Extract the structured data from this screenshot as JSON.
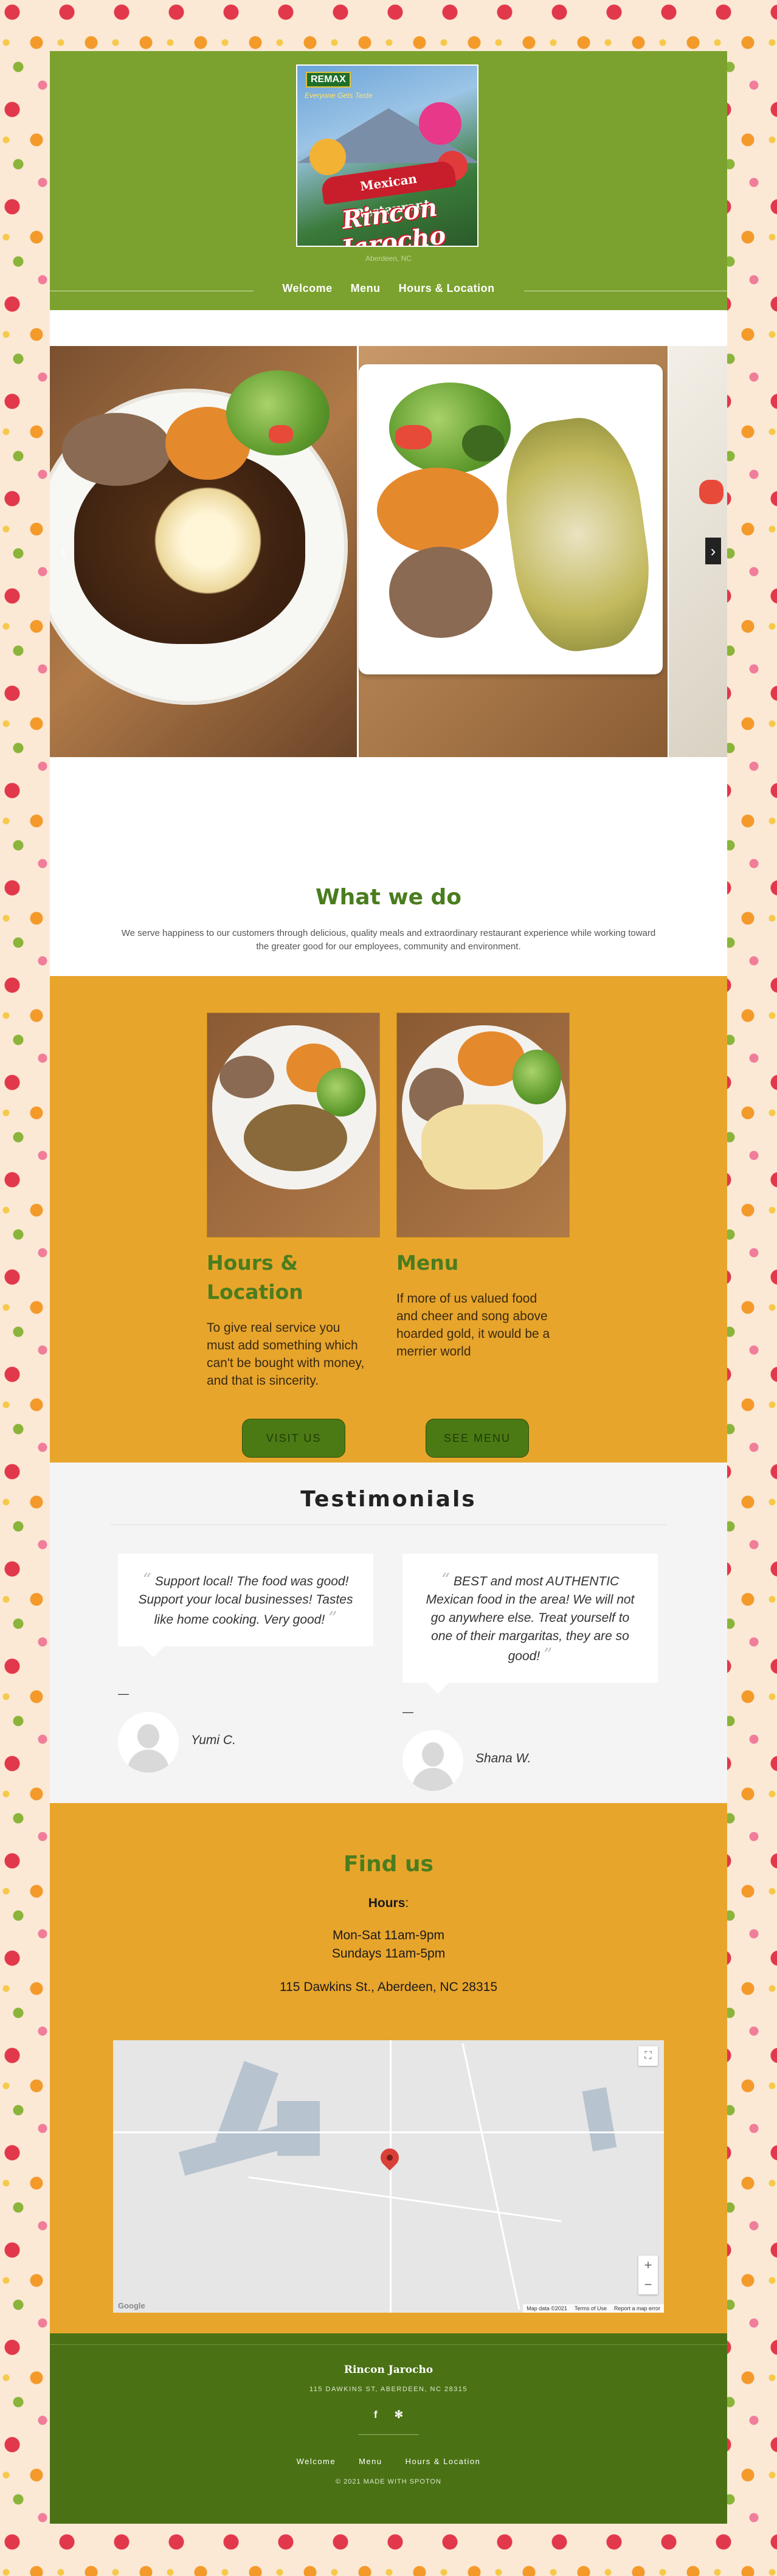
{
  "header": {
    "logo": {
      "tag": "REMAX",
      "subtitle": "Everyone Gets Taste",
      "banner": "Mexican Restaurant",
      "script": "Rincon Jarocho"
    },
    "location": "Aberdeen, NC",
    "nav": [
      "Welcome",
      "Menu",
      "Hours & Location"
    ]
  },
  "slider": {
    "prev_icon": "chevron-left-icon",
    "next_icon": "chevron-right-icon"
  },
  "what_we_do": {
    "title": "What we do",
    "text": "We serve happiness to our customers through delicious, quality meals and extraordinary restaurant experience while working toward the greater good for our employees, community and environment."
  },
  "services": [
    {
      "title": "Hours & Location",
      "text": "To give real service you must add something which can't be bought with money, and that is sincerity.",
      "button": "VISIT US"
    },
    {
      "title": "Menu",
      "text": "If more of us valued food and cheer and song above hoarded gold, it would be a merrier world",
      "button": "SEE MENU"
    }
  ],
  "testimonials": {
    "title": "Testimonials",
    "items": [
      {
        "quote": "Support local! The food was good! Support your local businesses! Tastes like home cooking. Very good!",
        "name": "Yumi C."
      },
      {
        "quote": "BEST and most AUTHENTIC Mexican food in the area! We will not go anywhere else. Treat yourself to one of their margaritas, they are so good!",
        "name": "Shana W."
      }
    ]
  },
  "find_us": {
    "title": "Find us",
    "hours_label": "Hours",
    "hours": [
      "Mon-Sat 11am-9pm",
      "Sundays 11am-5pm"
    ],
    "address": "115 Dawkins St., Aberdeen, NC 28315",
    "map": {
      "footer": [
        "Map data ©2021",
        "Terms of Use",
        "Report a map error"
      ],
      "provider": "Google"
    }
  },
  "footer": {
    "name": "Rincon Jarocho",
    "address": "115 DAWKINS ST, ABERDEEN, NC 28315",
    "social": [
      "f",
      "✻"
    ],
    "nav": [
      "Welcome",
      "Menu",
      "Hours & Location"
    ],
    "copyright": "© 2021 MADE WITH SPOTON"
  },
  "colors": {
    "header_green": "#7ba22f",
    "accent_green": "#4a7d1e",
    "orange": "#e8a52c",
    "footer_green": "#4a7215"
  }
}
